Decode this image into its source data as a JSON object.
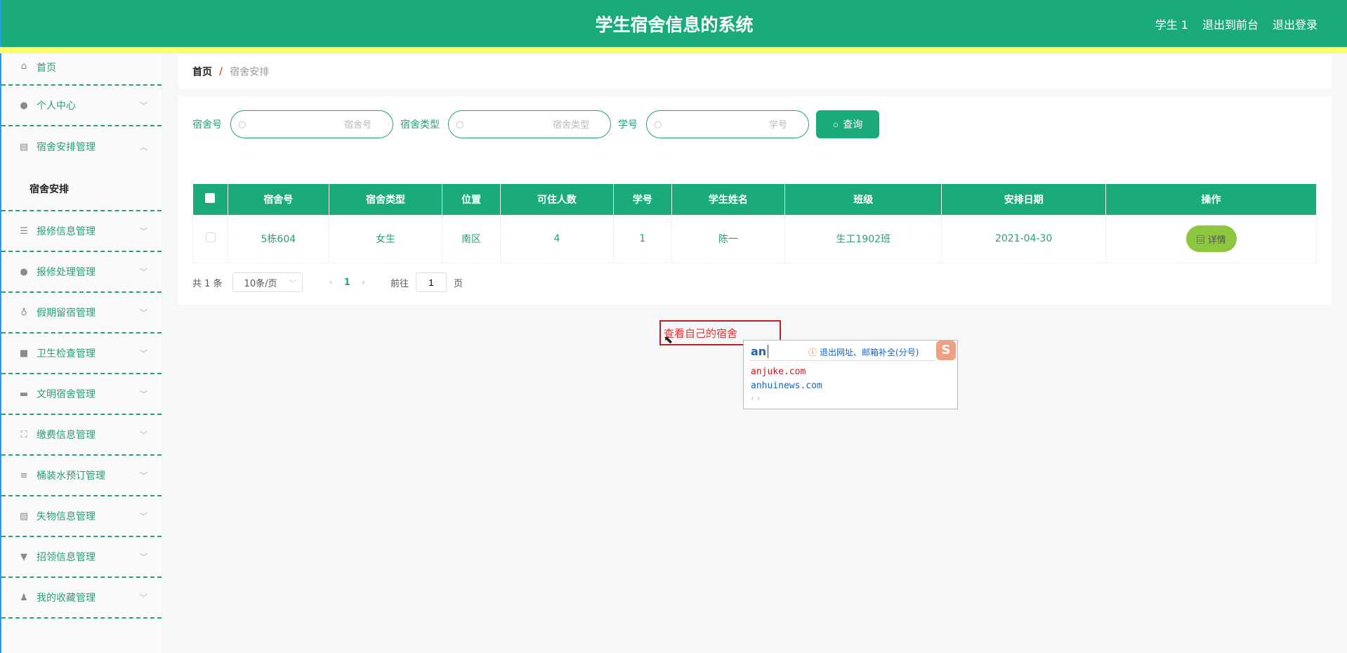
{
  "header": {
    "title": "学生宿舍信息的系统",
    "user": "学生 1",
    "front": "退出到前台",
    "logout": "退出登录"
  },
  "sidebar": {
    "items": [
      {
        "label": "首页",
        "icon": "home-icon"
      },
      {
        "label": "个人中心",
        "icon": "user-icon"
      },
      {
        "label": "宿舍安排管理",
        "icon": "clipboard-icon",
        "sub": "宿舍安排"
      },
      {
        "label": "报修信息管理",
        "icon": "sliders-icon"
      },
      {
        "label": "报修处理管理",
        "icon": "user-icon"
      },
      {
        "label": "假期留宿管理",
        "icon": "microphone-icon"
      },
      {
        "label": "卫生检查管理",
        "icon": "briefcase-icon"
      },
      {
        "label": "文明宿舍管理",
        "icon": "monitor-icon"
      },
      {
        "label": "缴费信息管理",
        "icon": "fullscreen-icon"
      },
      {
        "label": "桶装水预订管理",
        "icon": "list-icon"
      },
      {
        "label": "失物信息管理",
        "icon": "chart-icon"
      },
      {
        "label": "招领信息管理",
        "icon": "brush-icon"
      },
      {
        "label": "我的收藏管理",
        "icon": "stamp-icon"
      }
    ]
  },
  "breadcrumb": {
    "home": "首页",
    "sep": "/",
    "current": "宿舍安排"
  },
  "search": {
    "f1_label": "宿舍号",
    "f1_ph": "宿舍号",
    "f2_label": "宿舍类型",
    "f2_ph": "宿舍类型",
    "f3_label": "学号",
    "f3_ph": "学号",
    "button": "查询"
  },
  "table": {
    "headers": [
      "宿舍号",
      "宿舍类型",
      "位置",
      "可住人数",
      "学号",
      "学生姓名",
      "班级",
      "安排日期",
      "操作"
    ],
    "rows": [
      {
        "c0": "5栋604",
        "c1": "女生",
        "c2": "南区",
        "c3": "4",
        "c4": "1",
        "c5": "陈一",
        "c6": "生工1902班",
        "c7": "2021-04-30",
        "action": "详情"
      }
    ]
  },
  "pager": {
    "total": "共 1 条",
    "size": "10条/页",
    "page": "1",
    "goto": "前往",
    "goto_val": "1",
    "page_unit": "页"
  },
  "tooltip": "查看自己的宿舍",
  "ime": {
    "typed": "an",
    "hint": "退出网址、邮箱补全(分号)",
    "s1": "anjuke.com",
    "s2": "anhuinews.com",
    "nav": "‹ ›",
    "logo": "S"
  }
}
